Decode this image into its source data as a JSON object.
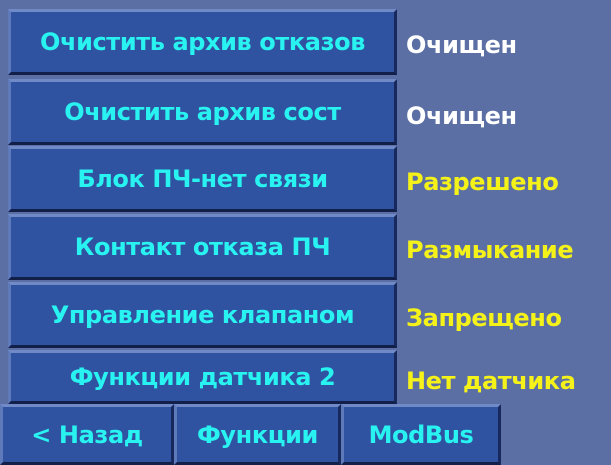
{
  "menu": {
    "items": [
      {
        "label": "Очистить архив отказов",
        "status": "Очищен"
      },
      {
        "label": "Очистить архив сост",
        "status": "Очищен"
      },
      {
        "label": "Блок ПЧ-нет связи",
        "status": "Разрешено"
      },
      {
        "label": "Контакт отказа ПЧ",
        "status": "Размыкание"
      },
      {
        "label": "Управление клапаном",
        "status": "Запрещено"
      },
      {
        "label": "Функции датчика 2",
        "status": "Нет датчика"
      }
    ]
  },
  "nav": {
    "back": "< Назад",
    "functions": "Функции",
    "modbus": "ModBus"
  },
  "colors": {
    "background": "#5b6fa5",
    "button": "#2f53a1",
    "button_text": "#29f3f1",
    "status_white": "#ffffff",
    "status_yellow": "#f5f219"
  }
}
